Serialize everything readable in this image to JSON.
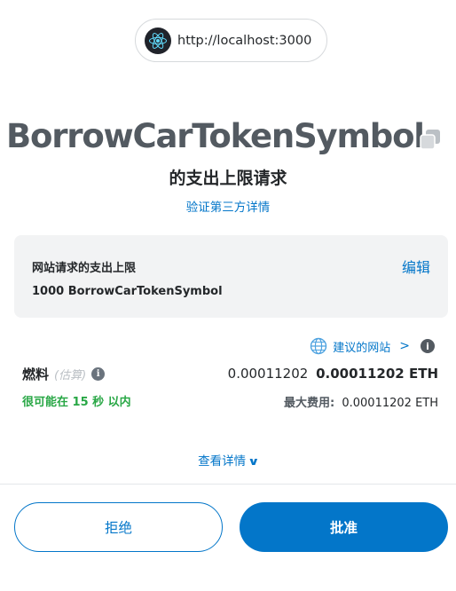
{
  "origin": {
    "url": "http://localhost:3000",
    "icon": "react-logo-icon"
  },
  "header": {
    "token_symbol": "BorrowCarTokenSymbol",
    "subtitle": "的支出上限请求",
    "verify_link": "验证第三方详情"
  },
  "spending_cap": {
    "label": "网站请求的支出上限",
    "value": "1000 BorrowCarTokenSymbol",
    "edit_label": "编辑"
  },
  "suggested_site": {
    "label": "建议的网站",
    "chevron": ">",
    "info": "i"
  },
  "gas": {
    "label": "燃料",
    "estimate_tag": "(估算)",
    "info": "i",
    "fiat_value": "0.00011202",
    "eth_value": "0.00011202 ETH",
    "time_estimate": "很可能在 15 秒 以内",
    "max_fee_label": "最大费用:",
    "max_fee_value": "0.00011202 ETH"
  },
  "details": {
    "view_label": "查看详情",
    "chevron": "∨"
  },
  "actions": {
    "reject_label": "拒绝",
    "approve_label": "批准"
  },
  "colors": {
    "primary": "#0376c9",
    "success": "#28a745",
    "text_dark": "#24272a",
    "title_grey": "#535a61",
    "panel_bg": "#f2f3f4"
  }
}
